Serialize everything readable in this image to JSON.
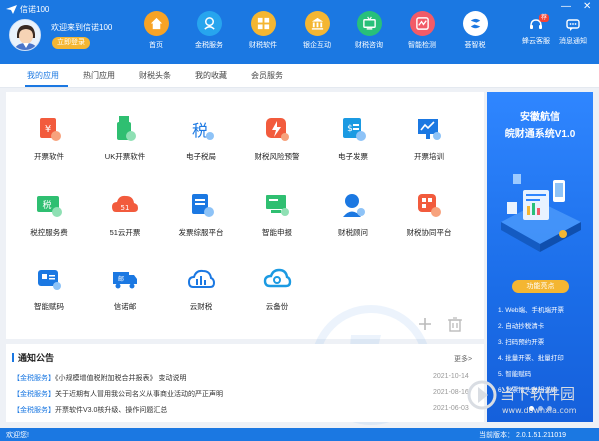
{
  "app": {
    "title": "信诺100",
    "welcome": "欢迎来到信诺100",
    "login_label": "立即登录"
  },
  "window_controls": {
    "minimize": "—",
    "close": "✕"
  },
  "nav": [
    {
      "label": "首页",
      "icon": "home-icon",
      "color": "#f7a326"
    },
    {
      "label": "金税服务",
      "icon": "tax-service-icon",
      "color": "#27a5ee"
    },
    {
      "label": "财税软件",
      "icon": "finance-software-icon",
      "color": "#f4b632"
    },
    {
      "label": "银企互动",
      "icon": "bank-interaction-icon",
      "color": "#f4b632"
    },
    {
      "label": "财税咨询",
      "icon": "consulting-tv-icon",
      "color": "#28c07a"
    },
    {
      "label": "智能检测",
      "icon": "smart-detect-icon",
      "color": "#f25b67"
    },
    {
      "label": "荟智税",
      "icon": "smart-tax-icon",
      "color": "#1b78e2"
    }
  ],
  "right_tools": [
    {
      "label": "蜂云客服",
      "icon": "headset-icon",
      "badge": "荐"
    },
    {
      "label": "消息通知",
      "icon": "message-icon"
    }
  ],
  "tabs": [
    "我的应用",
    "热门应用",
    "财税头条",
    "我的收藏",
    "会员服务"
  ],
  "apps": [
    {
      "label": "开票软件",
      "icon": "invoice-software-icon",
      "color": "#f25b3d"
    },
    {
      "label": "UK开票软件",
      "icon": "usb-key-invoice-icon",
      "color": "#2fbf71"
    },
    {
      "label": "电子税局",
      "icon": "e-tax-bureau-icon",
      "color": "#1b78e2"
    },
    {
      "label": "财税风险预警",
      "icon": "risk-alert-icon",
      "color": "#f25b3d"
    },
    {
      "label": "电子发票",
      "icon": "e-invoice-icon",
      "color": "#1b9ae2"
    },
    {
      "label": "开票培训",
      "icon": "invoice-training-icon",
      "color": "#1b78e2"
    },
    {
      "label": "税控服务费",
      "icon": "tax-control-fee-icon",
      "color": "#2fbf71"
    },
    {
      "label": "51云开票",
      "icon": "cloud-invoice-icon",
      "color": "#f25b3d"
    },
    {
      "label": "发票综服平台",
      "icon": "invoice-platform-icon",
      "color": "#1b78e2"
    },
    {
      "label": "智能申报",
      "icon": "smart-declare-icon",
      "color": "#2fbf71"
    },
    {
      "label": "财税顾问",
      "icon": "tax-advisor-icon",
      "color": "#1b78e2"
    },
    {
      "label": "财税协同平台",
      "icon": "collab-platform-icon",
      "color": "#f25b3d"
    },
    {
      "label": "智能赋码",
      "icon": "smart-code-icon",
      "color": "#1b78e2"
    },
    {
      "label": "信诺邮",
      "icon": "mail-truck-icon",
      "color": "#1b78e2"
    },
    {
      "label": "云财税",
      "icon": "cloud-tax-icon",
      "color": "#1b78e2"
    },
    {
      "label": "云备份",
      "icon": "cloud-backup-icon",
      "color": "#1b9ae2"
    }
  ],
  "notice": {
    "title": "通知公告",
    "more": "更多>",
    "rows": [
      {
        "tag": "【金税服务】",
        "text": "《小规模增值税附加税合并报表》 变动说明",
        "date": "2021-10-14"
      },
      {
        "tag": "【金税服务】",
        "text": "关于近期有人冒用我公司名义从事商业活动的严正声明",
        "date": "2021-08-16"
      },
      {
        "tag": "【金税服务】",
        "text": "开票软件V3.0核升级、操作问题汇总",
        "date": "2021-06-03"
      }
    ]
  },
  "ad": {
    "title_line1": "安徽航信",
    "title_line2": "皖财通系统V1.0",
    "feature_label": "功能亮点",
    "features": [
      "1. Web端、手机端开票",
      "2. 自动抄税清卡",
      "3. 扫码预约开票",
      "4. 批量开票、批量打印",
      "5. 智能赋码",
      "6. 发票抬头联想查询"
    ]
  },
  "site_watermark": {
    "line1": "当下软件园",
    "line2": "www.downxia.com"
  },
  "status": {
    "left": "欢迎您!",
    "right": "当前版本： 2.0.1.51.211019"
  }
}
